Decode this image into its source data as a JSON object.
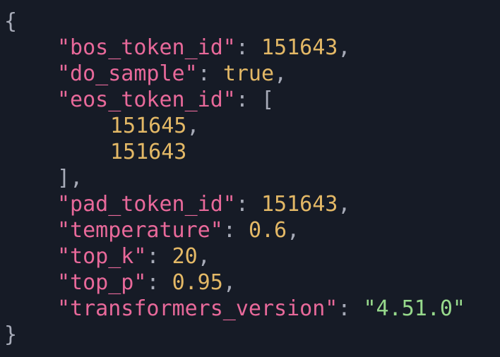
{
  "colors": {
    "background": "#161b26",
    "key": "#e8699a",
    "number": "#e3b866",
    "string": "#97d98c",
    "punctuation": "#a7abb8"
  },
  "json": {
    "open_brace": "{",
    "close_brace": "}",
    "bos_token_id": {
      "key": "\"bos_token_id\"",
      "value": "151643"
    },
    "do_sample": {
      "key": "\"do_sample\"",
      "value": "true"
    },
    "eos_token_id": {
      "key": "\"eos_token_id\"",
      "open": "[",
      "close": "]",
      "items": [
        "151645",
        "151643"
      ]
    },
    "pad_token_id": {
      "key": "\"pad_token_id\"",
      "value": "151643"
    },
    "temperature": {
      "key": "\"temperature\"",
      "value": "0.6"
    },
    "top_k": {
      "key": "\"top_k\"",
      "value": "20"
    },
    "top_p": {
      "key": "\"top_p\"",
      "value": "0.95"
    },
    "transformers_version": {
      "key": "\"transformers_version\"",
      "value": "\"4.51.0\""
    }
  }
}
